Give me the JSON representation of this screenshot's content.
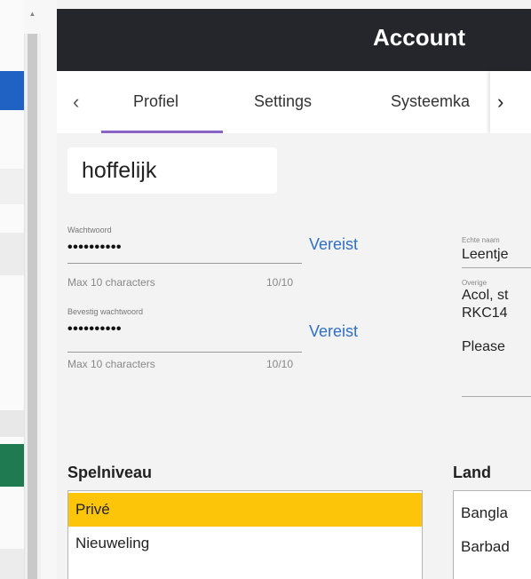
{
  "window": {
    "title": "Account"
  },
  "tabs": {
    "prev_icon": "chevron-left-icon",
    "next_icon": "chevron-right-icon",
    "items": [
      {
        "label": "Profiel",
        "active": true
      },
      {
        "label": "Settings",
        "active": false
      },
      {
        "label": "Systeemka",
        "active": false
      }
    ]
  },
  "profile": {
    "username": "hoffelijk",
    "password": {
      "label": "Wachtwoord",
      "value": "••••••••••",
      "required": "Vereist",
      "help": "Max 10 characters",
      "count": "10/10"
    },
    "confirm_password": {
      "label": "Bevestig wachtwoord",
      "value": "••••••••••",
      "required": "Vereist",
      "help": "Max 10 characters",
      "count": "10/10"
    },
    "real_name": {
      "label": "Echte naam",
      "value": "Leentje"
    },
    "other": {
      "label": "Overige",
      "line1": "Acol, st",
      "line2": "RKC14",
      "line3": "Please"
    }
  },
  "level": {
    "title": "Spelniveau",
    "options": [
      {
        "label": "Privé",
        "selected": true
      },
      {
        "label": "Nieuweling",
        "selected": false
      }
    ]
  },
  "country": {
    "title": "Land",
    "options": [
      {
        "label": "Bangla",
        "selected": false
      },
      {
        "label": "Barbad",
        "selected": false
      }
    ]
  },
  "colors": {
    "header_bg": "#25262b",
    "accent_underline": "#8a63c7",
    "link_blue": "#2f6fc4",
    "selected_item": "#fcc50a"
  }
}
